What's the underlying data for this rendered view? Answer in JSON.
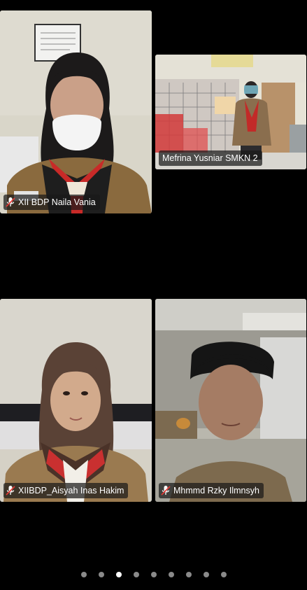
{
  "participants": [
    {
      "name": "XII BDP Naila Vania",
      "muted": true
    },
    {
      "name": "Mefrina Yusniar SMKN 2",
      "muted": false
    },
    {
      "name": "XIIBDP_Aisyah Inas Hakim",
      "muted": true
    },
    {
      "name": "Mhmmd Rzky Ilmnsyh",
      "muted": true
    }
  ],
  "icons": {
    "mute": "mic-muted-icon"
  },
  "pagination": {
    "total_pages": 9,
    "current_page": 3
  },
  "colors": {
    "background": "#000000",
    "label_bg": "#191919",
    "dot_active": "#ffffff",
    "dot_inactive": "#8a8a8a"
  }
}
